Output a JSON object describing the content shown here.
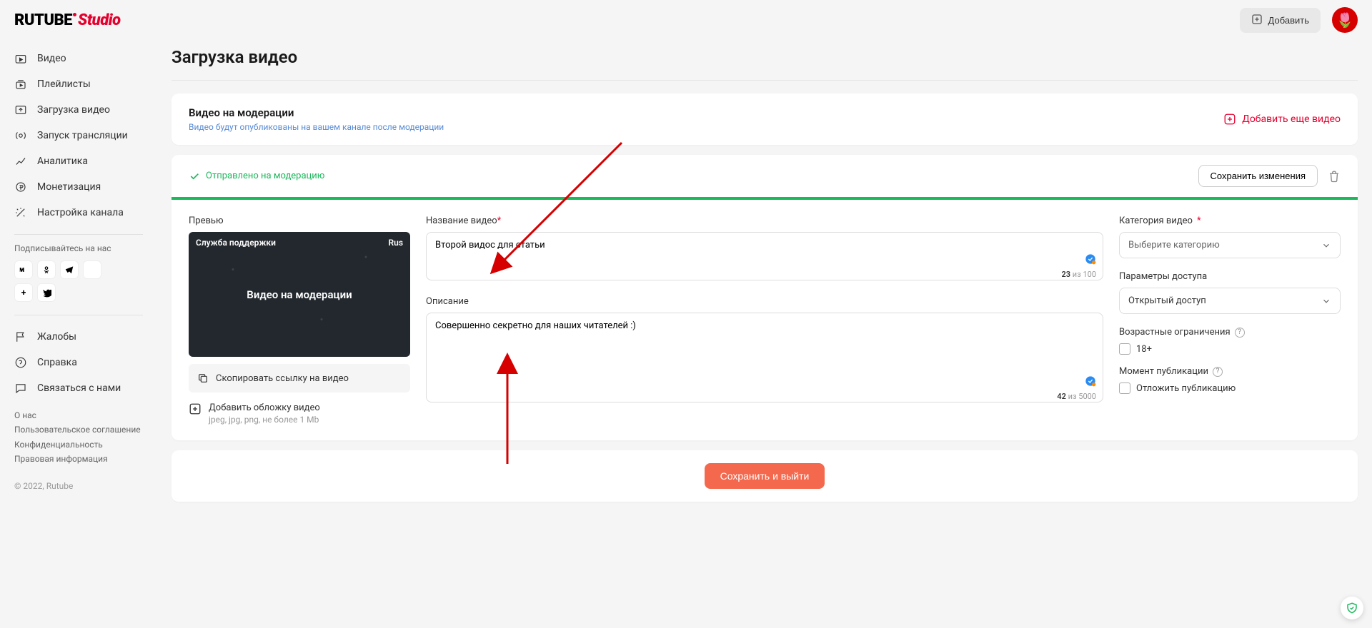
{
  "header": {
    "logo_left": "RUTUBE",
    "logo_right": "Studio",
    "add_button": "Добавить"
  },
  "sidebar": {
    "items": [
      {
        "label": "Видео"
      },
      {
        "label": "Плейлисты"
      },
      {
        "label": "Загрузка видео"
      },
      {
        "label": "Запуск трансляции"
      },
      {
        "label": "Аналитика"
      },
      {
        "label": "Монетизация"
      },
      {
        "label": "Настройка канала"
      }
    ],
    "follow_label": "Подписывайтесь на нас",
    "bottom_items": [
      {
        "label": "Жалобы"
      },
      {
        "label": "Справка"
      },
      {
        "label": "Связаться с нами"
      }
    ],
    "footer": {
      "about": "О нас",
      "terms": "Пользовательское соглашение",
      "privacy": "Конфиденциальность",
      "legal": "Правовая информация"
    },
    "copyright": "© 2022, Rutube"
  },
  "page": {
    "title": "Загрузка видео"
  },
  "notice": {
    "title": "Видео на модерации",
    "subtitle": "Видео будут опубликованы на вашем канале после модерации",
    "add_more": "Добавить еще видео"
  },
  "form": {
    "status": "Отправлено на модерацию",
    "save_changes": "Сохранить изменения",
    "preview_label": "Превью",
    "thumb": {
      "top_left": "Служба поддержки",
      "top_right": "Rus",
      "center": "Видео на модерации"
    },
    "copy_link": "Скопировать ссылку на видео",
    "add_cover": "Добавить обложку видео",
    "add_cover_hint": "jpeg, jpg, png, не более 1 Mb",
    "title_label": "Название видео",
    "title_value": "Второй видос для статьи",
    "title_count": "23",
    "title_max": "100",
    "desc_label": "Описание",
    "desc_value": "Совершенно секретно для наших читателей :)",
    "desc_count": "42",
    "desc_max": "5000",
    "count_of": "из",
    "category_label": "Категория видео",
    "category_placeholder": "Выберите категорию",
    "access_label": "Параметры доступа",
    "access_value": "Открытый доступ",
    "age_label": "Возрастные ограничения",
    "age_checkbox": "18+",
    "publish_label": "Момент публикации",
    "publish_checkbox": "Отложить публикацию"
  },
  "save_exit": "Сохранить и выйти"
}
